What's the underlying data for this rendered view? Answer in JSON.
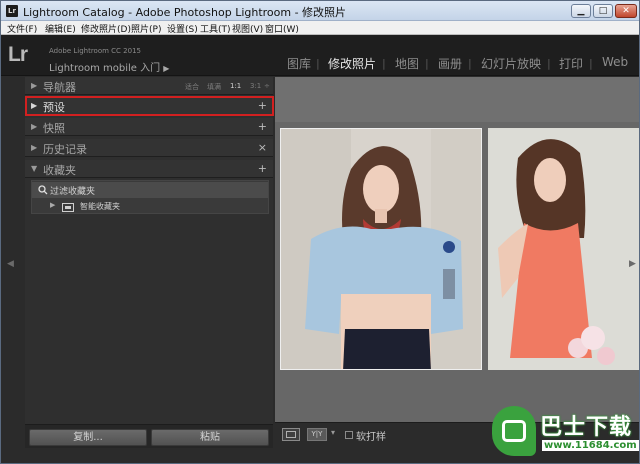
{
  "window": {
    "title": "Lightroom Catalog - Adobe Photoshop Lightroom - 修改照片",
    "app_mini_logo": "Lr",
    "minimize_label": "▁",
    "maximize_label": "□",
    "close_label": "✕"
  },
  "menu": {
    "items": [
      "文件(F)",
      "编辑(E)",
      "修改照片(D)",
      "照片(P)",
      "设置(S)",
      "工具(T)",
      "视图(V)",
      "窗口(W)"
    ]
  },
  "identity": {
    "logo": "Lr",
    "subtitle": "Adobe Lightroom CC 2015",
    "mobile_text": "Lightroom mobile 入门",
    "mobile_arrow": "▶"
  },
  "modules": {
    "items": [
      "图库",
      "修改照片",
      "地图",
      "画册",
      "幻灯片放映",
      "打印",
      "Web"
    ],
    "active": "修改照片",
    "separator": "|"
  },
  "left_panel": {
    "navigator": {
      "label": "导航器",
      "toggle": "▶",
      "zoom_options": [
        "适合",
        "填满",
        "1:1",
        "3:1"
      ],
      "zoom_selected": "1:1",
      "zoom_arrow": "÷"
    },
    "presets": {
      "label": "预设",
      "toggle": "▶",
      "action": "+"
    },
    "snapshots": {
      "label": "快照",
      "toggle": "▶",
      "action": "+"
    },
    "history": {
      "label": "历史记录",
      "toggle": "▶",
      "action": "×"
    },
    "collections": {
      "label": "收藏夹",
      "toggle": "▼",
      "action": "+",
      "search_label": "过滤收藏夹",
      "smart_collection_label": "智能收藏夹",
      "smart_collection_toggle": "▶"
    },
    "copy_button": "复制...",
    "paste_button": "粘贴",
    "collapse_left_arrow": "◀",
    "collapse_right_arrow": "▶"
  },
  "toolbar": {
    "view_compare": "Y|Y",
    "view_dropdown": "▾",
    "soft_proofing_label": "软打样"
  },
  "watermark": {
    "brand": "巴士下载",
    "url": "www.11684.com"
  },
  "colors": {
    "highlight_border": "#d22020",
    "panel_bg": "#2f2f2f",
    "canvas_bg": "#676767",
    "accent_green": "#3aa23e"
  }
}
